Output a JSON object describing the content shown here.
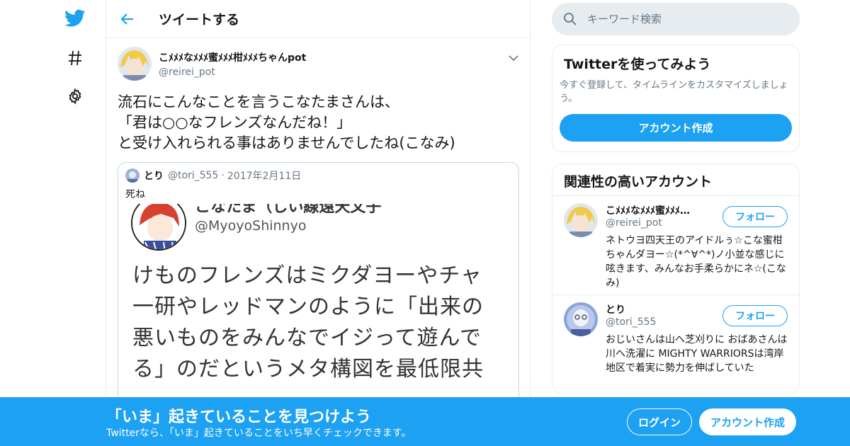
{
  "colors": {
    "accent": "#1da1f2",
    "text_secondary": "#657786",
    "border": "#e6ecf0"
  },
  "nav": {
    "icons": [
      "twitter-bird-icon",
      "hashtag-icon",
      "gear-icon"
    ]
  },
  "header": {
    "title": "ツイートする"
  },
  "tweet": {
    "author_name": "こﾒﾒﾒなﾒﾒﾒ蜜ﾒﾒﾒ柑ﾒﾒﾒちゃんpot",
    "author_handle": "@reirei_pot",
    "text": "流石にこんなことを言うこなたまさんは、\n「君は○○なフレンズなんだね！」\nと受け入れられる事はありませんでしたね(こなみ)",
    "quote": {
      "name": "とり",
      "handle": "@tori_555",
      "sep": "·",
      "date": "2017年2月11日",
      "text": "死ね",
      "image": {
        "name_cut": "こなたま（しい線遠天文子",
        "handle": "@MyoyoShinnyo",
        "text": "けものフレンズはミクダヨーやチャ\n一研やレッドマンのように「出来の\n悪いものをみんなでイジって遊んで\nる」のだというメタ構図を最低限共"
      }
    }
  },
  "search": {
    "placeholder": "キーワード検索"
  },
  "signup_card": {
    "title": "Twitterを使ってみよう",
    "subtitle": "今すぐ登録して、タイムラインをカスタマイズしましょう。",
    "button": "アカウント作成"
  },
  "related": {
    "title": "関連性の高いアカウント",
    "accounts": [
      {
        "name": "こﾒﾒﾒなﾒﾒﾒ蜜ﾒﾒﾒ…",
        "handle": "@reirei_pot",
        "bio": "ネトウヨ四天王のアイドルぅ☆こな蜜柑ちゃんダヨー☆(*^∀^*)ノ小並な感じに呟きます、みんなお手柔らかにネ☆(こなみ)",
        "follow": "フォロー"
      },
      {
        "name": "とり",
        "handle": "@tori_555",
        "bio": "おじいさんは山へ芝刈りに おばあさんは川へ洗濯に MIGHTY WARRIORSは湾岸地区で着実に勢力を伸ばしていた",
        "follow": "フォロー"
      }
    ]
  },
  "banner": {
    "title": "「いま」起きていることを見つけよう",
    "subtitle": "Twitterなら、「いま」起きていることをいち早くチェックできます。",
    "login": "ログイン",
    "signup": "アカウント作成"
  }
}
